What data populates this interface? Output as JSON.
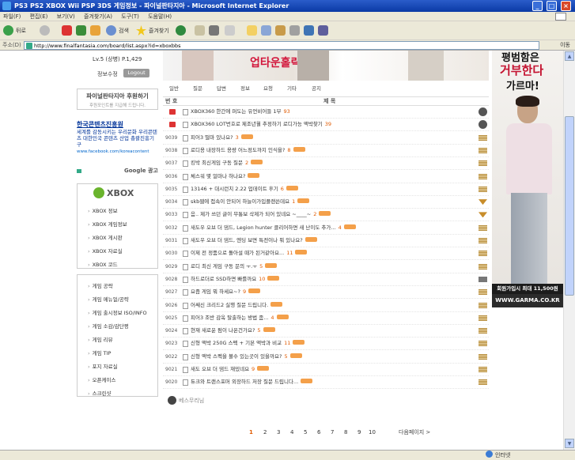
{
  "window": {
    "title": "PS3 PS2 XBOX Wii PSP 3DS 게임정보 - 파이널판타지아 - Microsoft Internet Explorer"
  },
  "menu": [
    "파일(F)",
    "편집(E)",
    "보기(V)",
    "즐겨찾기(A)",
    "도구(T)",
    "도움말(H)"
  ],
  "toolbar": {
    "back": "뒤로",
    "search": "검색",
    "favorites": "즐겨찾기"
  },
  "address": {
    "label": "주소(D)",
    "url": "http://www.finalfantasia.com/board/list.aspx?id=xboxbbs",
    "go": "이동"
  },
  "sidebar": {
    "level": "Lv.5 (상병) P.1,429",
    "profile": "정보수정",
    "logout": "Logout",
    "sponsor_title": "파이널판타지아 후원하기",
    "sponsor_sub": "후원포인트를 지급해 드립니다.",
    "kca_title": "한국콘텐츠진흥원",
    "kca_body": "세계를 감동시키는 우리문화 우리콘텐츠 대한민국 콘텐츠 산업 총괄진흥기구",
    "kca_link": "www.facebook.com/koreacontent",
    "google": "Google 광고",
    "xbox_logo": "XBOX",
    "xbox_items": [
      "XBOX 정보",
      "XBOX 게임정보",
      "XBOX 게시판",
      "XBOX 자료실",
      "XBOX 코드"
    ],
    "cat_items": [
      "게임 공략",
      "게임 메뉴얼/공략",
      "게임 출시정보 ISO/INFO",
      "게임 소감/감단평",
      "게임 리뷰",
      "게임 TIP",
      "포지 자료실",
      "오픈케이스",
      "스크린샷"
    ]
  },
  "banner": {
    "text": "업타운홀릭"
  },
  "tabs": [
    "일반",
    "질문",
    "답변",
    "정보",
    "요청",
    "기타",
    "공지"
  ],
  "table": {
    "col_no": "번 호",
    "col_title": "제 목"
  },
  "rows": [
    {
      "no": "",
      "title": "XBOX360 한간에 퍼도는 유언비어들 1부",
      "count": "93",
      "new": false,
      "icon": "av",
      "notice": true
    },
    {
      "no": "",
      "title": "XBOX360 LOT번호로 제조년월 추정하기 로디가능 액박찾기",
      "count": "39",
      "new": false,
      "icon": "av",
      "notice": true
    },
    {
      "no": "9039",
      "title": "피어3 떨마 있나요?",
      "count": "3",
      "new": true,
      "icon": "st"
    },
    {
      "no": "9038",
      "title": "로디용 내장하드 용량 어느정도까지 인식을?",
      "count": "8",
      "new": true,
      "icon": "st"
    },
    {
      "no": "9037",
      "title": "킹박 최신게임 구동 질문",
      "count": "2",
      "new": true,
      "icon": "st"
    },
    {
      "no": "9036",
      "title": "체스워 몇 얼마나 하나요?",
      "count": "",
      "new": true,
      "icon": "st"
    },
    {
      "no": "9035",
      "title": "13146 + 대시런치 2.22 업데이트 후기",
      "count": "6",
      "new": true,
      "icon": "st"
    },
    {
      "no": "9034",
      "title": "skb웹에 접속이 안되어 하늘이가입플랜쓴데요",
      "count": "1",
      "new": true,
      "icon": "ch"
    },
    {
      "no": "9033",
      "title": "음.. 제가 쓰던 글이 무통보 삭제가 되어 있네요 ~____~",
      "count": "2",
      "new": true,
      "icon": "ch"
    },
    {
      "no": "9032",
      "title": "새도우 오브 더 댐드, Legion hunter 클리어하면 새 난이도 추가...",
      "count": "4",
      "new": true,
      "icon": "st"
    },
    {
      "no": "9031",
      "title": "새도우 오브 더 댐드, 엔딩 보면 특전이나 뭐 있나요?",
      "count": "",
      "new": true,
      "icon": "st"
    },
    {
      "no": "9030",
      "title": "이제 전 정품으로 돌아설 때가 된거같아요...",
      "count": "11",
      "new": true,
      "icon": "st"
    },
    {
      "no": "9029",
      "title": "로디 최신 게임 구동 문의 ㅜ.ㅜ",
      "count": "5",
      "new": true,
      "icon": "st"
    },
    {
      "no": "9028",
      "title": "하드로더로 SSD하면 빠를까요",
      "count": "10",
      "new": true,
      "icon": "gr"
    },
    {
      "no": "9027",
      "title": "요즘 게임 뭐 하세요~?",
      "count": "9",
      "new": true,
      "icon": "st"
    },
    {
      "no": "9026",
      "title": "어쌔신 크리드2 실행 질문 드립니다.",
      "count": "",
      "new": true,
      "icon": "st"
    },
    {
      "no": "9025",
      "title": "피어3 조반 감옥 탈출하는 방법 좀...",
      "count": "4",
      "new": true,
      "icon": "st"
    },
    {
      "no": "9024",
      "title": "현재 새로운 펌이 나온건가요?",
      "count": "5",
      "new": true,
      "icon": "st"
    },
    {
      "no": "9023",
      "title": "신형 액박 250G 스펙 + 기본 액박과 비교",
      "count": "11",
      "new": true,
      "icon": "st"
    },
    {
      "no": "9022",
      "title": "신형 액박 스펙을 볼수 있는곳이 있을까요?",
      "count": "5",
      "new": true,
      "icon": "st"
    },
    {
      "no": "9021",
      "title": "새도 오브 더 댐드 재밌네요",
      "count": "9",
      "new": true,
      "icon": "st"
    },
    {
      "no": "9020",
      "title": "듀크와 트랜스포머 외장하드 저장 질문 드립니다...",
      "count": "",
      "new": true,
      "icon": "st"
    }
  ],
  "writer": "베스무리님",
  "pager": {
    "pages": [
      "1",
      "2",
      "3",
      "4",
      "5",
      "6",
      "7",
      "8",
      "9",
      "10"
    ],
    "next": "다음페이지 >"
  },
  "ad": {
    "line1": "평범함은",
    "line2": "거부한다",
    "line3": "가르마!",
    "caption": "회원가입시 최대 11,500원",
    "site": "WWW.GARMA.CO.KR"
  },
  "status": {
    "zone": "인터넷"
  }
}
